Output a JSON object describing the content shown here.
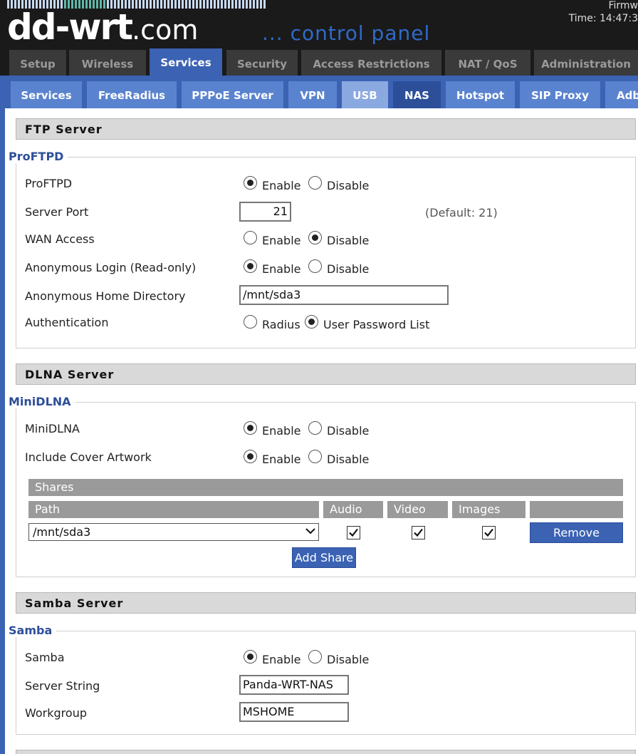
{
  "header": {
    "logo_main": "dd-wrt",
    "logo_domain": ".com",
    "tagline": "... control panel",
    "firmware": "Firmw",
    "time": "Time: 14:47:3"
  },
  "main_tabs": [
    "Setup",
    "Wireless",
    "Services",
    "Security",
    "Access Restrictions",
    "NAT / QoS",
    "Administration"
  ],
  "main_tab_active": "Services",
  "sub_tabs": [
    "Services",
    "FreeRadius",
    "PPPoE Server",
    "VPN",
    "USB",
    "NAS",
    "Hotspot",
    "SIP Proxy",
    "Adb"
  ],
  "sub_tab_active": "NAS",
  "ftp": {
    "title": "FTP Server",
    "legend": "ProFTPD",
    "proftpd_label": "ProFTPD",
    "port_label": "Server Port",
    "port_value": "21",
    "port_hint": "(Default: 21)",
    "wan_label": "WAN Access",
    "anon_label": "Anonymous Login (Read-only)",
    "home_label": "Anonymous Home Directory",
    "home_value": "/mnt/sda3",
    "auth_label": "Authentication",
    "auth_radius": "Radius",
    "auth_list": "User Password List",
    "proftpd_enabled": true,
    "wan_enabled": false,
    "anon_enabled": true,
    "auth_mode": "User Password List"
  },
  "dlna": {
    "title": "DLNA Server",
    "legend": "MiniDLNA",
    "minidlna_label": "MiniDLNA",
    "cover_label": "Include Cover Artwork",
    "minidlna_enabled": true,
    "cover_enabled": true,
    "shares_header": "Shares",
    "columns": [
      "Path",
      "Audio",
      "Video",
      "Images"
    ],
    "share_path": "/mnt/sda3",
    "share_audio": true,
    "share_video": true,
    "share_images": true,
    "remove_label": "Remove",
    "add_label": "Add Share"
  },
  "samba": {
    "title": "Samba Server",
    "legend": "Samba",
    "samba_label": "Samba",
    "samba_enabled": true,
    "server_string_label": "Server String",
    "server_string_value": "Panda-WRT-NAS",
    "workgroup_label": "Workgroup",
    "workgroup_value": "MSHOME"
  },
  "radio": {
    "enable": "Enable",
    "disable": "Disable"
  },
  "colors": {
    "accent": "#3b62b3",
    "header_bg": "#1a1a1a",
    "legend": "#2d4f99"
  }
}
